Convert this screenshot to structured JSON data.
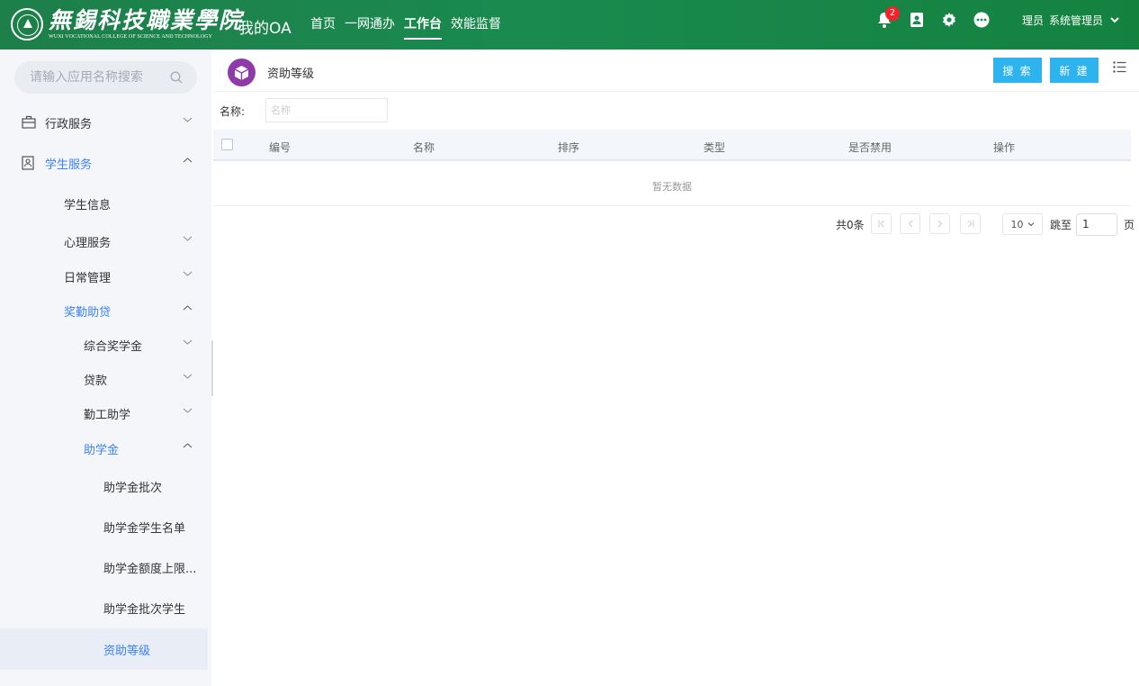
{
  "header": {
    "logo_cn": "無錫科技職業學院",
    "logo_en": "WUXI VOCATIONAL COLLEGE OF SCIENCE AND TECHNOLOGY",
    "app_name": "我的OA",
    "nav": [
      {
        "label": "首页",
        "active": false
      },
      {
        "label": "一网通办",
        "active": false
      },
      {
        "label": "工作台",
        "active": true
      },
      {
        "label": "效能监督",
        "active": false
      }
    ],
    "notification_count": "2",
    "user_role": "理员",
    "user_name": "系统管理员"
  },
  "sidebar": {
    "search_placeholder": "请输入应用名称搜索",
    "items": [
      {
        "label": "行政服务",
        "icon": "briefcase-icon",
        "expanded": false
      },
      {
        "label": "学生服务",
        "icon": "id-card-icon",
        "expanded": true
      },
      {
        "label": "学生信息"
      },
      {
        "label": "心理服务",
        "expanded": false
      },
      {
        "label": "日常管理",
        "expanded": false
      },
      {
        "label": "奖勤助贷",
        "expanded": true
      },
      {
        "label": "综合奖学金",
        "expanded": false
      },
      {
        "label": "贷款",
        "expanded": false
      },
      {
        "label": "勤工助学",
        "expanded": false
      },
      {
        "label": "助学金",
        "expanded": true
      },
      {
        "label": "助学金批次"
      },
      {
        "label": "助学金学生名单"
      },
      {
        "label": "助学金额度上限..."
      },
      {
        "label": "助学金批次学生"
      },
      {
        "label": "资助等级",
        "selected": true
      }
    ]
  },
  "page": {
    "title": "资助等级",
    "search_button": "搜 索",
    "new_button": "新 建",
    "filter_label": "名称:",
    "filter_placeholder": "名称",
    "columns": [
      "编号",
      "名称",
      "排序",
      "类型",
      "是否禁用",
      "操作"
    ],
    "empty_text": "暂无数据",
    "pagination": {
      "total_text": "共0条",
      "page_size": "10",
      "jump_label": "跳至",
      "jump_value": "1",
      "page_suffix": "页"
    }
  },
  "colors": {
    "header_bg": "#1a8a4f",
    "accent_blue": "#3b82f6",
    "button_blue": "#2db4ef",
    "page_icon_bg": "#8e3aa8",
    "badge_red": "#f5222d"
  }
}
